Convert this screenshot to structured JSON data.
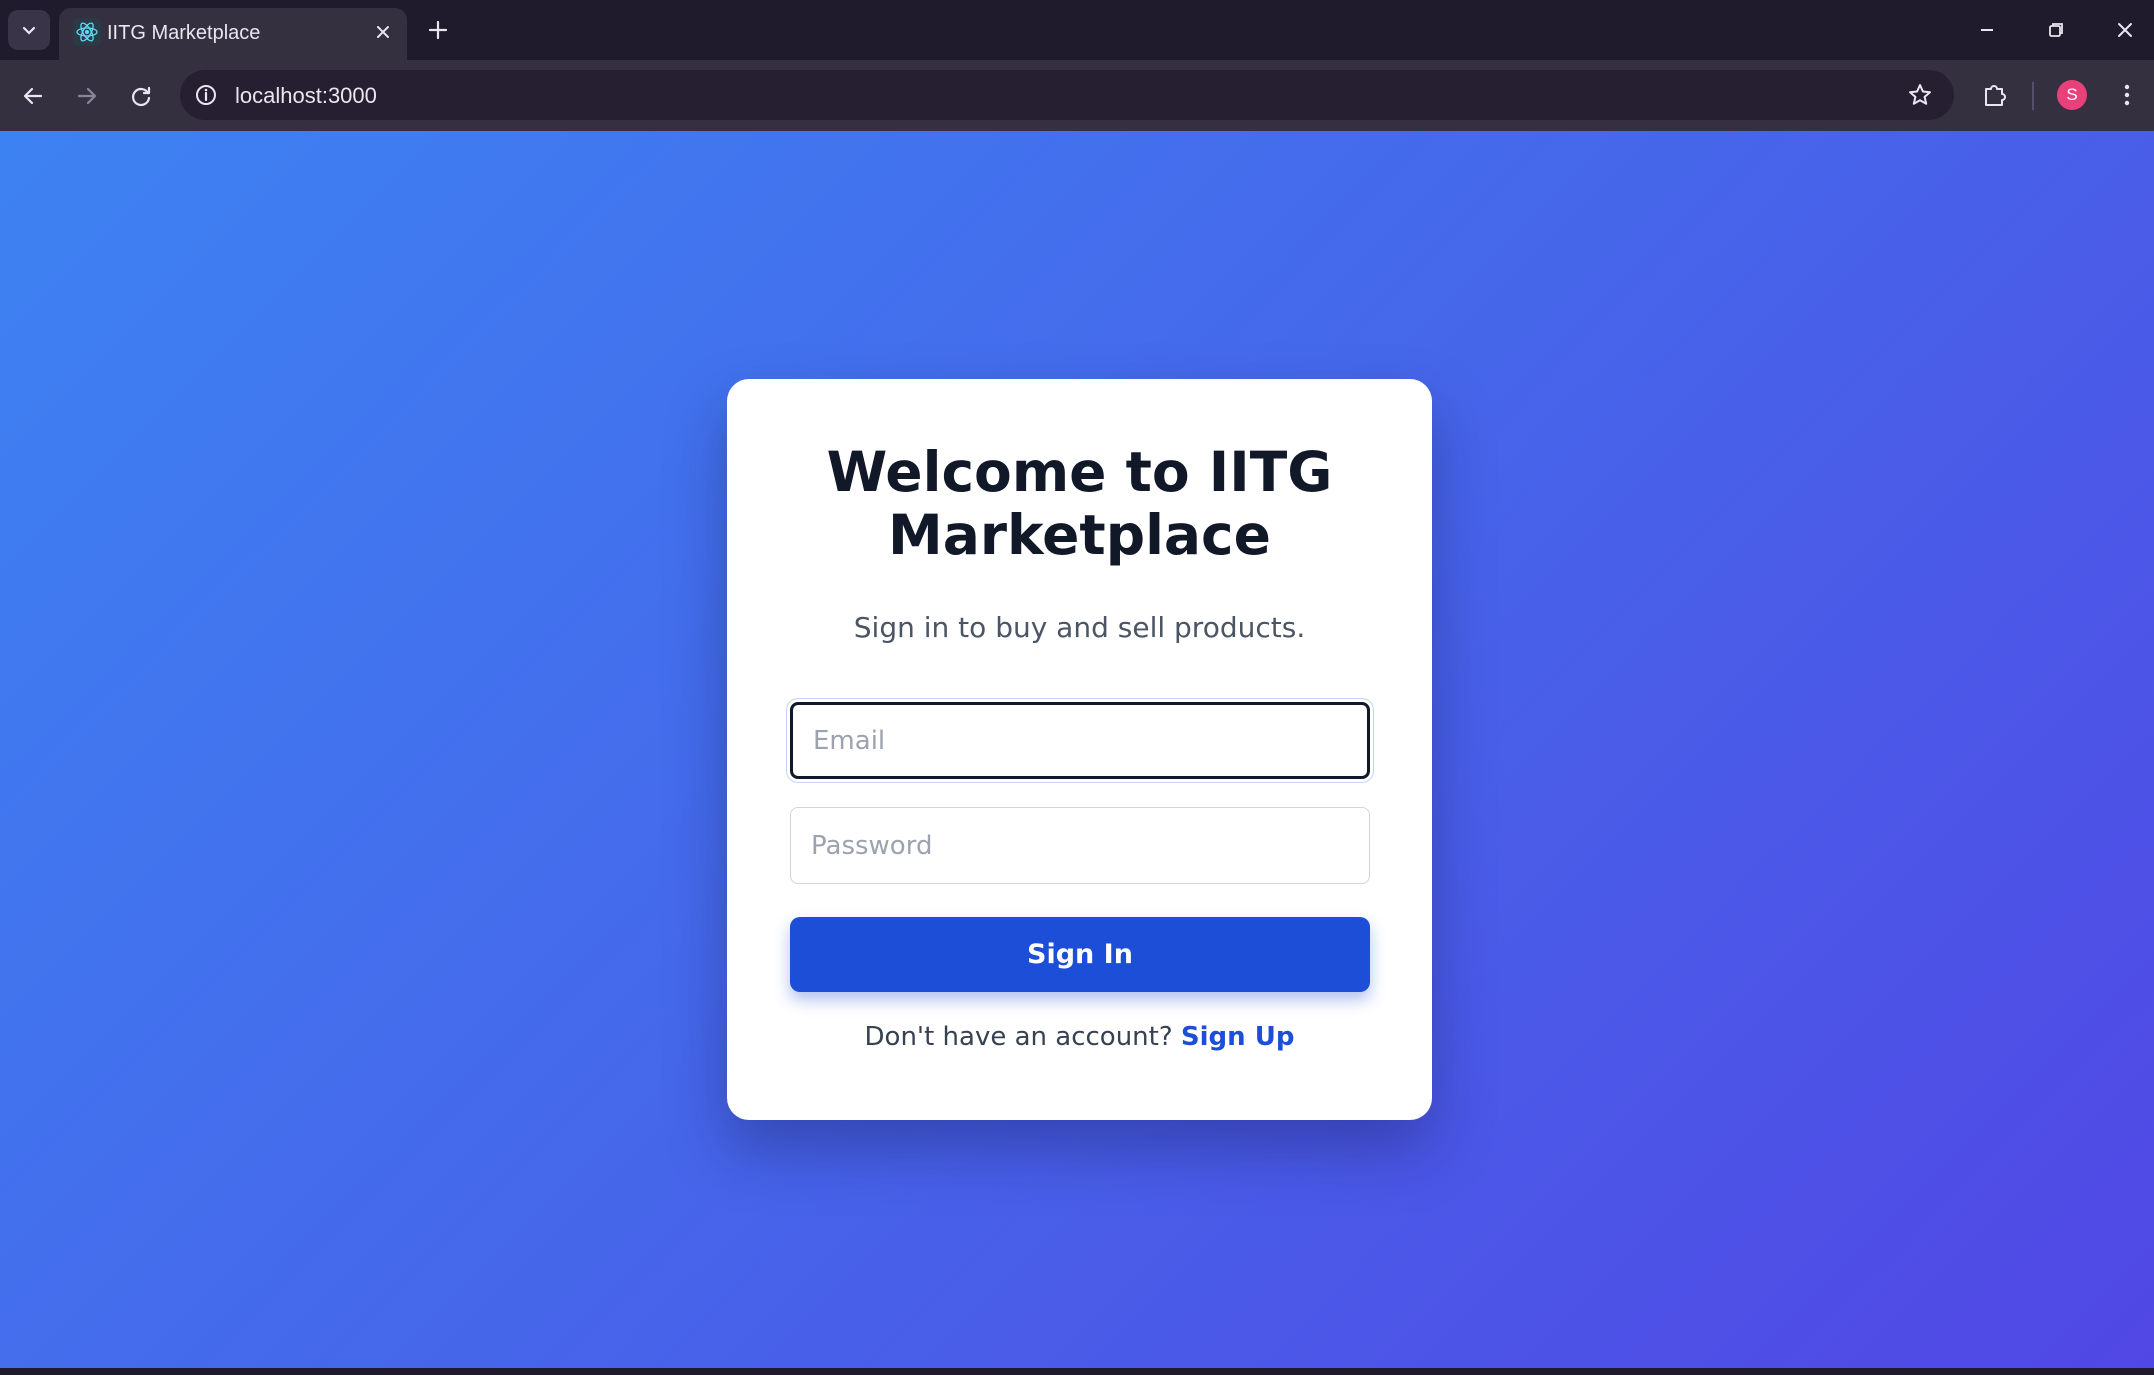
{
  "browser": {
    "tab_title": "IITG Marketplace",
    "url": "localhost:3000",
    "profile_initial": "S",
    "icons": {
      "tab_list": "chevron-down-icon",
      "favicon": "react-icon",
      "tab_close": "close-icon",
      "new_tab": "plus-icon",
      "minimize": "minimize-icon",
      "restore": "restore-icon",
      "close_window": "close-icon",
      "back": "back-arrow-icon",
      "forward": "forward-arrow-icon",
      "reload": "reload-icon",
      "site_info": "info-icon",
      "bookmark": "star-icon",
      "extensions": "puzzle-icon",
      "menu": "kebab-menu-icon"
    },
    "colors": {
      "frame": "#1f1b2d",
      "toolbar": "#35303f",
      "avatar": "#e8407a"
    }
  },
  "login": {
    "title": "Welcome to IITG Marketplace",
    "subtitle": "Sign in to buy and sell products.",
    "email_placeholder": "Email",
    "email_value": "",
    "password_placeholder": "Password",
    "password_value": "",
    "signin_label": "Sign In",
    "signup_prompt": "Don't have an account?",
    "signup_link": "Sign Up"
  },
  "colors": {
    "background_gradient_start": "#3d82f3",
    "background_gradient_end": "#5147e5",
    "primary_button": "#1d4ed8",
    "title_text": "#111827"
  }
}
